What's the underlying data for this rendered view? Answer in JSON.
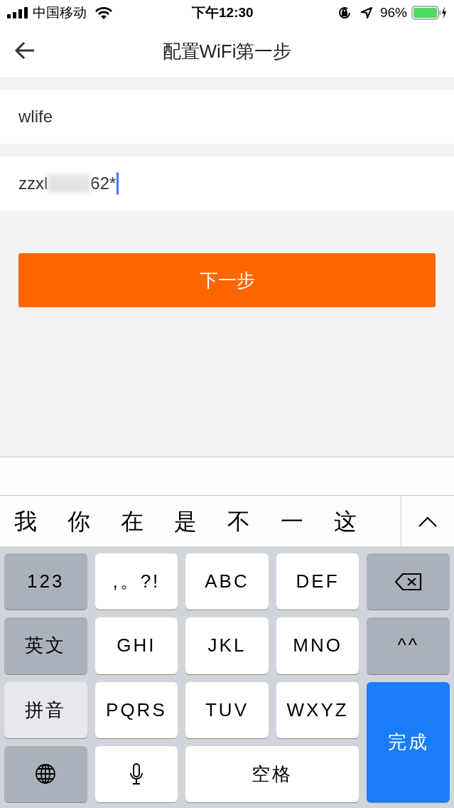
{
  "status_bar": {
    "carrier": "中国移动",
    "time": "下午12:30",
    "battery": "96%"
  },
  "nav": {
    "title": "配置WiFi第一步"
  },
  "fields": [
    {
      "value": "wlife",
      "kind": "text"
    },
    {
      "value": "zzxl",
      "value_end": "62*",
      "kind": "password",
      "focused": true
    }
  ],
  "next_button": "下一步",
  "candidates": [
    "我",
    "你",
    "在",
    "是",
    "不",
    "一",
    "这"
  ],
  "keys": [
    {
      "kind": "function",
      "label": "123"
    },
    {
      "kind": "letter",
      "label": ",。?!"
    },
    {
      "kind": "letter",
      "label": "ABC"
    },
    {
      "kind": "letter",
      "label": "DEF"
    },
    {
      "kind": "backspace"
    },
    {
      "kind": "mode",
      "label": "英文",
      "selected": false
    },
    {
      "kind": "letter",
      "label": "GHI"
    },
    {
      "kind": "letter",
      "label": "JKL"
    },
    {
      "kind": "letter",
      "label": "MNO"
    },
    {
      "kind": "function",
      "label": "^^"
    },
    {
      "kind": "mode",
      "label": "拼音",
      "selected": true
    },
    {
      "kind": "letter",
      "label": "PQRS"
    },
    {
      "kind": "letter",
      "label": "TUV"
    },
    {
      "kind": "letter",
      "label": "WXYZ"
    },
    {
      "kind": "done",
      "label": "完成"
    },
    {
      "kind": "globe"
    },
    {
      "kind": "mic"
    },
    {
      "kind": "space",
      "label": "空格"
    }
  ]
}
